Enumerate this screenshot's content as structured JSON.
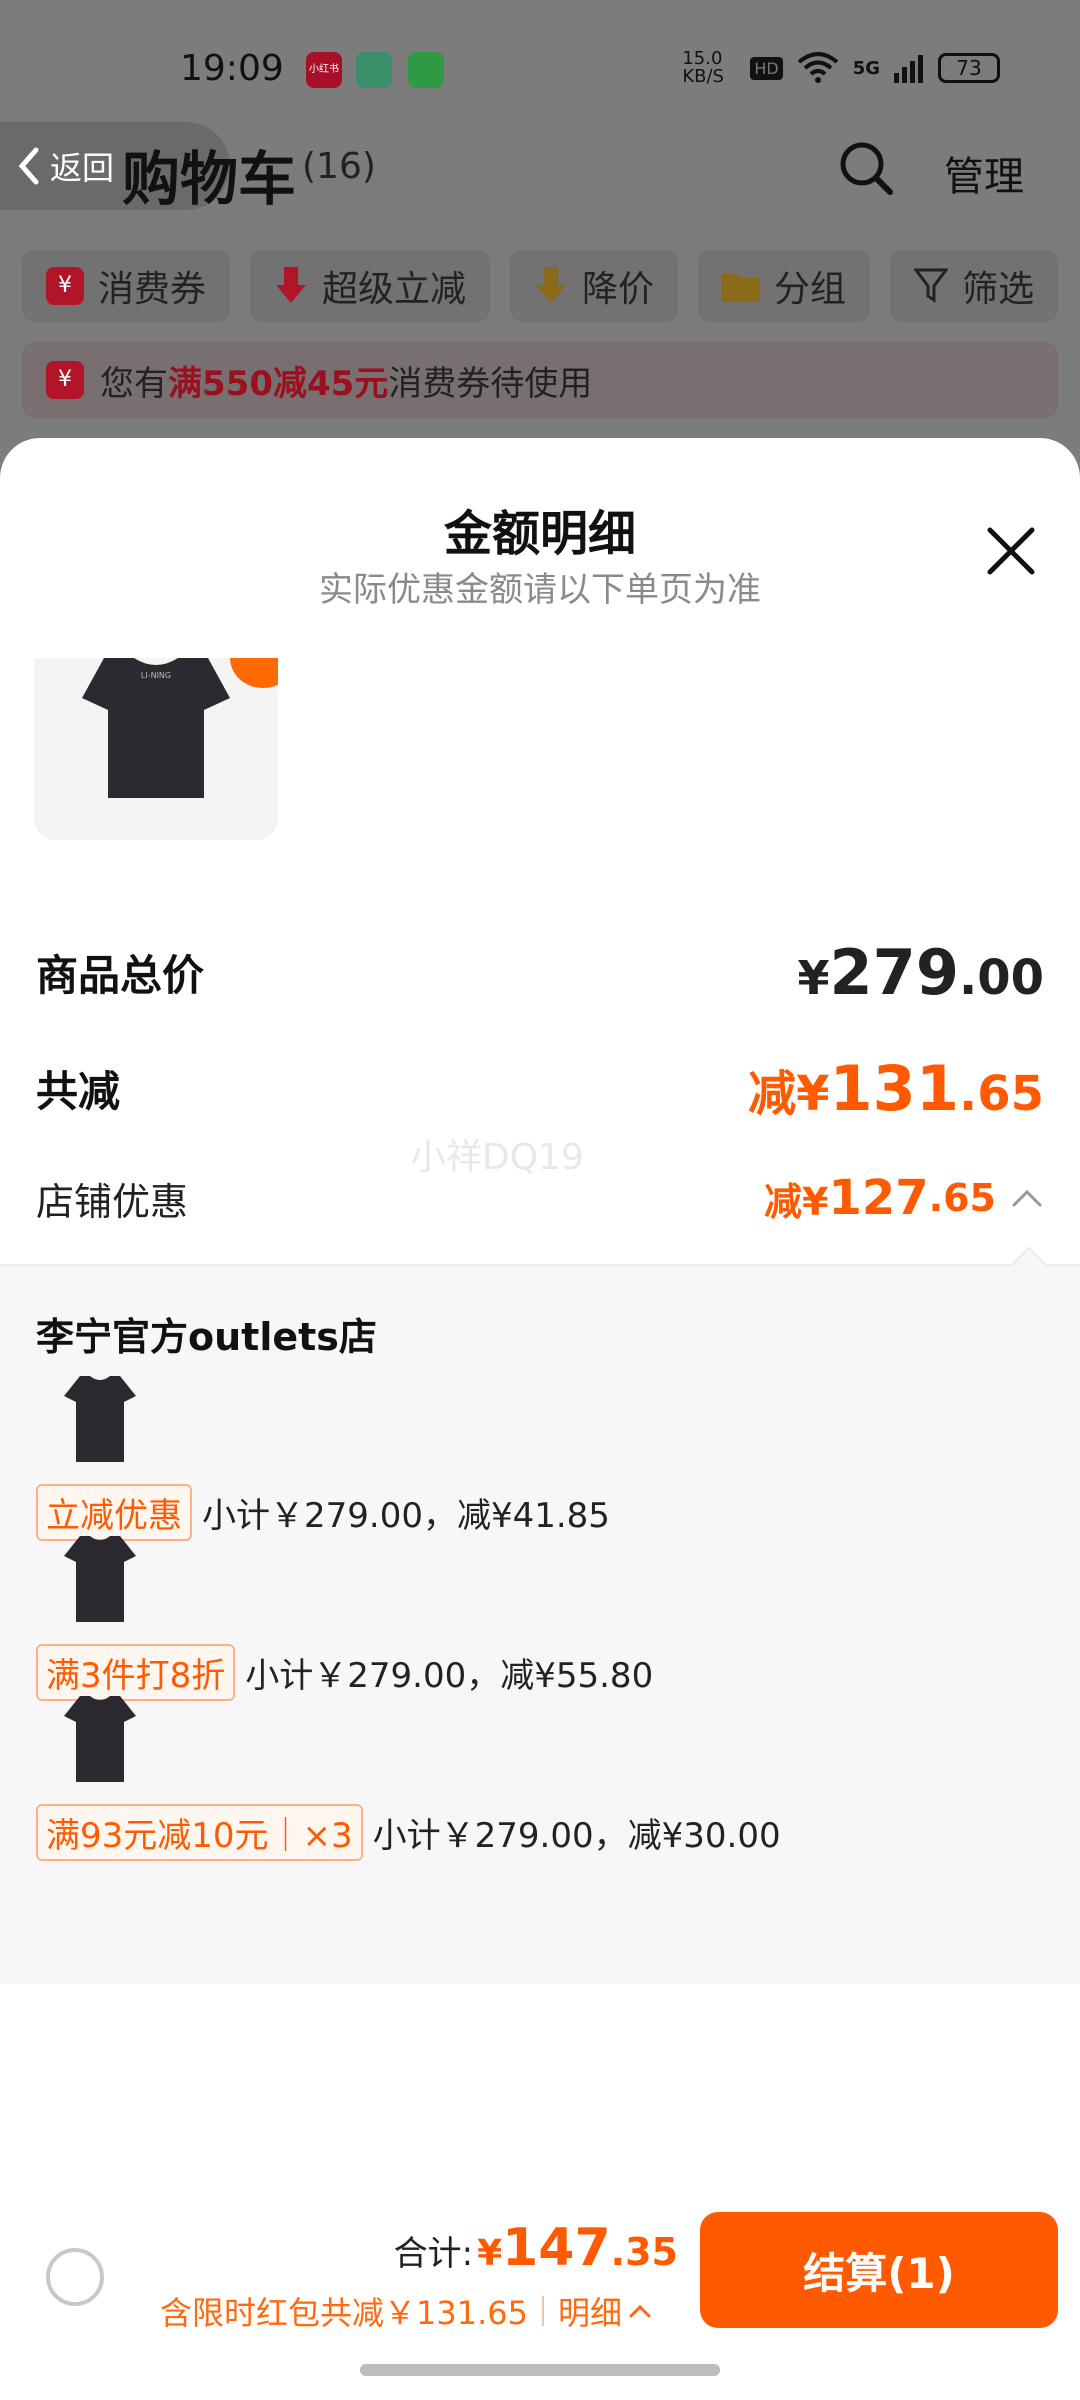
{
  "status_bar": {
    "time": "19:09",
    "apps": [
      "小红书",
      "",
      ""
    ],
    "net_speed": "15.0 KB/S",
    "hd": "HD",
    "signal": "5G",
    "battery": "73"
  },
  "nav": {
    "back_label": "返回",
    "title": "购物车",
    "count": "(16)",
    "manage_label": "管理"
  },
  "filters": [
    {
      "label": "消费券",
      "icon": "coupon-icon"
    },
    {
      "label": "超级立减",
      "icon": "arrow-down-icon"
    },
    {
      "label": "降价",
      "icon": "price-drop-icon"
    },
    {
      "label": "分组",
      "icon": "folder-icon"
    },
    {
      "label": "筛选",
      "icon": "filter-icon"
    }
  ],
  "coupon_bar": {
    "prefix": "您有",
    "highlight": "满550减45元",
    "suffix": "消费券待使用"
  },
  "sheet": {
    "title": "金额明细",
    "subtitle": "实际优惠金额请以下单页为准",
    "watermark": "小祥DQ19",
    "total_price": {
      "label": "商品总价",
      "symbol": "¥",
      "integer": "279",
      "decimal": ".00"
    },
    "total_discount": {
      "label": "共减",
      "prefix": "减¥",
      "integer": "131",
      "decimal": ".65"
    },
    "store_discount": {
      "label": "店铺优惠",
      "prefix": "减¥",
      "integer": "127",
      "decimal": ".65"
    },
    "store_name": "李宁官方outlets店",
    "promos": [
      {
        "tag": "立减优惠",
        "text": "小计￥279.00，减¥41.85"
      },
      {
        "tag": "满3件打8折",
        "text": "小计￥279.00，减¥55.80"
      },
      {
        "tag": "满93元减10元｜×3",
        "text": "小计￥279.00，减¥30.00"
      }
    ]
  },
  "bottom": {
    "total_label": "合计:",
    "total_symbol": "¥",
    "total_integer": "147",
    "total_decimal": ".35",
    "discount_text": "含限时红包共减￥131.65",
    "detail_label": "明细",
    "checkout_label": "结算(1)"
  },
  "colors": {
    "accent": "#ff5a00",
    "coupon_red": "#b2152a"
  }
}
